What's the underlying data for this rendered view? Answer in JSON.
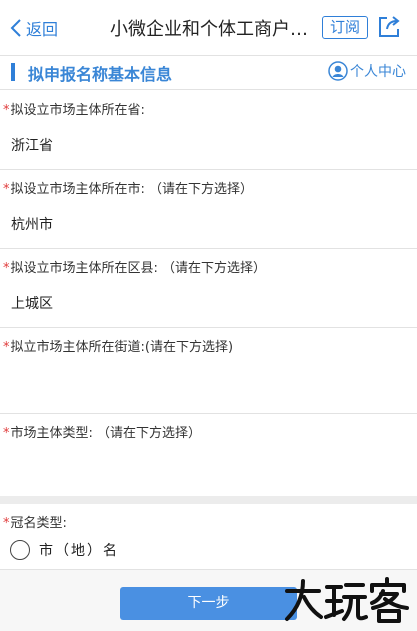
{
  "navbar": {
    "back_label": "返回",
    "title": "小微企业和个体工商户…",
    "subscribe_label": "订阅",
    "share_icon": "share-icon"
  },
  "section": {
    "title": "拟申报名称基本信息",
    "user_center_label": "个人中心"
  },
  "fields": [
    {
      "label": "拟设立市场主体所在省:",
      "value": "浙江省"
    },
    {
      "label": "拟设立市场主体所在市: （请在下方选择）",
      "value": "杭州市"
    },
    {
      "label": "拟设立市场主体所在区县: （请在下方选择）",
      "value": "上城区"
    },
    {
      "label": "拟立市场主体所在街道:(请在下方选择)",
      "value": ""
    },
    {
      "label": "市场主体类型: （请在下方选择）",
      "value": ""
    },
    {
      "label": "冠名类型:",
      "value": ""
    }
  ],
  "required_mark": "*",
  "crown_option": {
    "label": "市（地）名",
    "selected": false
  },
  "footer": {
    "next_label": "下一步"
  },
  "colors": {
    "accent": "#2f7fd8",
    "button": "#4a90e2",
    "required": "#e03a3a"
  }
}
